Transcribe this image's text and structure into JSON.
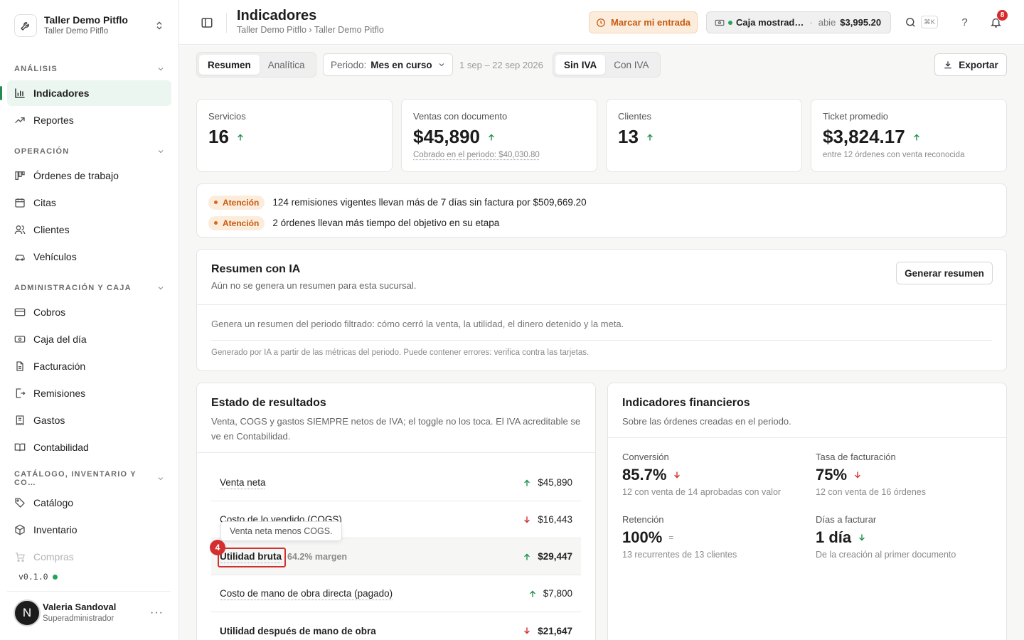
{
  "org": {
    "name": "Taller Demo Pitflo",
    "sub": "Taller Demo Pitflo"
  },
  "sidebar": {
    "sections": [
      {
        "title": "ANÁLISIS",
        "items": [
          {
            "label": "Indicadores",
            "icon": "bar-chart-icon",
            "active": true
          },
          {
            "label": "Reportes",
            "icon": "trend-icon"
          }
        ]
      },
      {
        "title": "OPERACIÓN",
        "items": [
          {
            "label": "Órdenes de trabajo",
            "icon": "kanban-icon"
          },
          {
            "label": "Citas",
            "icon": "calendar-icon"
          },
          {
            "label": "Clientes",
            "icon": "users-icon"
          },
          {
            "label": "Vehículos",
            "icon": "car-icon"
          }
        ]
      },
      {
        "title": "ADMINISTRACIÓN Y CAJA",
        "items": [
          {
            "label": "Cobros",
            "icon": "credit-card-icon"
          },
          {
            "label": "Caja del día",
            "icon": "cash-icon"
          },
          {
            "label": "Facturación",
            "icon": "document-icon"
          },
          {
            "label": "Remisiones",
            "icon": "file-export-icon"
          },
          {
            "label": "Gastos",
            "icon": "receipt-icon"
          },
          {
            "label": "Contabilidad",
            "icon": "book-icon"
          }
        ]
      },
      {
        "title": "CATÁLOGO, INVENTARIO Y CO…",
        "items": [
          {
            "label": "Catálogo",
            "icon": "tag-icon"
          },
          {
            "label": "Inventario",
            "icon": "box-icon"
          },
          {
            "label": "Compras",
            "icon": "cart-icon"
          }
        ]
      }
    ],
    "version": "v0.1.0",
    "user": {
      "initial": "N",
      "name": "Valeria Sandoval",
      "role": "Superadministrador",
      "menu": "···"
    }
  },
  "header": {
    "title": "Indicadores",
    "breadcrumb": "Taller Demo Pitflo › Taller Demo Pitflo",
    "entrada_label": "Marcar mi entrada",
    "caja": {
      "name": "Caja mostrad…",
      "sep": "·",
      "status": "abie",
      "amount": "$3,995.20"
    },
    "shortcut": "⌘K",
    "help": "?",
    "notifications": "8"
  },
  "toolbar": {
    "view_tabs": [
      "Resumen",
      "Analítica"
    ],
    "periodo_label": "Periodo:",
    "periodo_value": "Mes en curso",
    "range": "1 sep – 22 sep 2026",
    "iva_tabs": [
      "Sin IVA",
      "Con IVA"
    ],
    "export_label": "Exportar"
  },
  "kpis": [
    {
      "label": "Servicios",
      "value": "16",
      "sub": ""
    },
    {
      "label": "Ventas con documento",
      "value": "$45,890",
      "sub": "Cobrado en el periodo: $40,030.80"
    },
    {
      "label": "Clientes",
      "value": "13",
      "sub": ""
    },
    {
      "label": "Ticket promedio",
      "value": "$3,824.17",
      "sub": "entre 12 órdenes con venta reconocida"
    }
  ],
  "alerts": [
    {
      "tag": "Atención",
      "text": "124 remisiones vigentes llevan más de 7 días sin factura por $509,669.20"
    },
    {
      "tag": "Atención",
      "text": "2 órdenes llevan más tiempo del objetivo en su etapa"
    }
  ],
  "ia": {
    "title": "Resumen con IA",
    "subtitle": "Aún no se genera un resumen para esta sucursal.",
    "button": "Generar resumen",
    "body": "Genera un resumen del periodo filtrado: cómo cerró la venta, la utilidad, el dinero detenido y la meta.",
    "note": "Generado por IA a partir de las métricas del periodo. Puede contener errores: verifica contra las tarjetas."
  },
  "estado": {
    "title": "Estado de resultados",
    "desc": "Venta, COGS y gastos SIEMPRE netos de IVA; el toggle no los toca. El IVA acreditable se ve en Contabilidad.",
    "rows": [
      {
        "label": "Venta neta",
        "value": "$45,890",
        "trend": "up"
      },
      {
        "label": "Costo de lo vendido (COGS)",
        "value": "$16,443",
        "trend": "down"
      },
      {
        "label": "Utilidad bruta",
        "margin": "64.2% margen",
        "value": "$29,447",
        "trend": "up"
      },
      {
        "label": "Costo de mano de obra directa (pagado)",
        "value": "$7,800",
        "trend": "up"
      },
      {
        "label": "Utilidad después de mano de obra",
        "value": "$21,647",
        "trend": "down"
      }
    ],
    "tooltip": "Venta neta menos COGS.",
    "step": "4"
  },
  "financieros": {
    "title": "Indicadores financieros",
    "desc": "Sobre las órdenes creadas en el periodo.",
    "metrics": [
      {
        "label": "Conversión",
        "value": "85.7%",
        "trend": "down",
        "sub": "12 con venta de 14 aprobadas con valor"
      },
      {
        "label": "Tasa de facturación",
        "value": "75%",
        "trend": "down",
        "sub": "12 con venta de 16 órdenes"
      },
      {
        "label": "Retención",
        "value": "100%",
        "trend": "flat",
        "flat_symbol": "=",
        "sub": "13 recurrentes de 13 clientes"
      },
      {
        "label": "Días a facturar",
        "value": "1 día",
        "trend": "down-green",
        "sub": "De la creación al primer documento"
      }
    ]
  },
  "colors": {
    "accent_green": "#1f8f4f",
    "warning_bg": "#fcecdc",
    "warning_text": "#c65c10",
    "danger": "#d32f2f"
  }
}
